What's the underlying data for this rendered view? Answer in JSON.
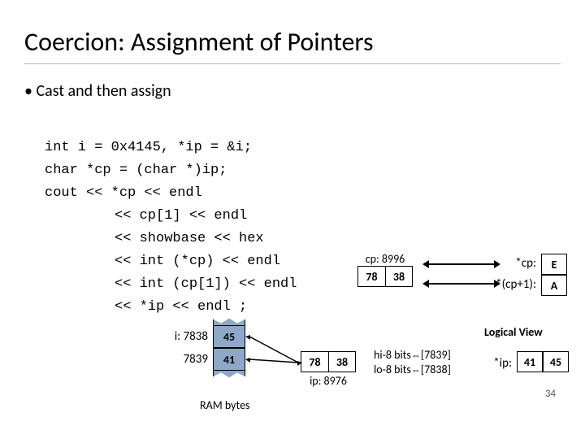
{
  "title": "Coercion: Assignment of Pointers",
  "bullet": "• Cast and then assign",
  "code": {
    "l1": "int i = 0x4145, *ip = &i;",
    "l2": "char *cp = (char *)ip;",
    "l3": "cout << *cp << endl",
    "l4": "<< cp[1] << endl",
    "l5": "<< showbase << hex",
    "l6": "<< int (*cp) << endl",
    "l7": "<< int (cp[1]) << endl",
    "l8": "<< *ip << endl ;"
  },
  "ram": {
    "rows": [
      {
        "addr": "i: 7838",
        "val": "45"
      },
      {
        "addr": "7839",
        "val": "41"
      }
    ],
    "label": "RAM bytes"
  },
  "cp": {
    "addr": "cp: 8996",
    "b0": "78",
    "b1": "38"
  },
  "ip_view": {
    "b0": "78",
    "b1": "38",
    "addr": "ip: 8976"
  },
  "deref": {
    "cp_label": "*cp:",
    "cp_val": "E",
    "cp1_label": "*(cp+1):",
    "cp1_val": "A",
    "ip_label": "*ip:",
    "ip_v0": "41",
    "ip_v1": "45"
  },
  "bits": {
    "hi": "hi-8 bits",
    "hi_ref": "[7839]",
    "lo": "lo-8 bits",
    "lo_ref": "[7838]"
  },
  "logical_view": "Logical View",
  "slide_num": "34"
}
